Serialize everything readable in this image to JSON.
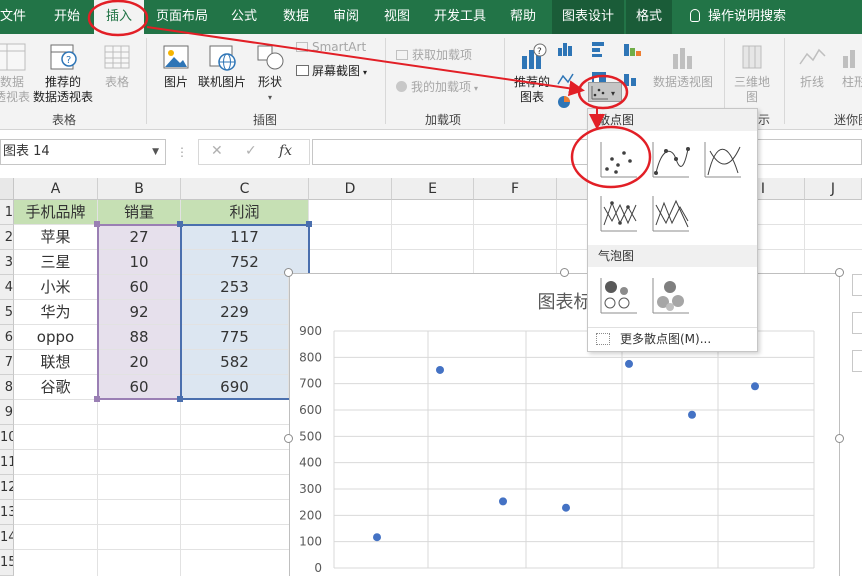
{
  "tabs": [
    {
      "label": "文件"
    },
    {
      "label": "开始"
    },
    {
      "label": "插入"
    },
    {
      "label": "页面布局"
    },
    {
      "label": "公式"
    },
    {
      "label": "数据"
    },
    {
      "label": "审阅"
    },
    {
      "label": "视图"
    },
    {
      "label": "开发工具"
    },
    {
      "label": "帮助"
    },
    {
      "label": "图表设计"
    },
    {
      "label": "格式"
    }
  ],
  "tellme": "操作说明搜索",
  "ribbon": {
    "pivot_label": [
      "数据",
      "透视表"
    ],
    "recommended_pivot_label": [
      "推荐的",
      "数据透视表"
    ],
    "table_label": "表格",
    "group_tables": "表格",
    "picture_label": "图片",
    "online_picture_label": "联机图片",
    "shapes_label": "形状",
    "smartart_label": "SmartArt",
    "screenshot_label": "屏幕截图",
    "group_illustrations": "插图",
    "get_addins_label": "获取加载项",
    "my_addins_label": "我的加载项",
    "group_addins": "加载项",
    "recommended_charts_label": [
      "推荐的",
      "图表"
    ],
    "pivot_chart_label": "数据透视图",
    "map3d_label": [
      "三维地",
      "图"
    ],
    "group_tours": "示",
    "line_label": "折线",
    "column_label": "柱形",
    "group_sparklines": "迷你图"
  },
  "formula_bar": {
    "name_box": "图表 14",
    "cancel": "✕",
    "enter": "✓",
    "fx": "fx"
  },
  "columns": [
    "A",
    "B",
    "C",
    "D",
    "E",
    "F",
    "G",
    "H",
    "I",
    "J"
  ],
  "rows": [
    "1",
    "2",
    "3",
    "4",
    "5",
    "6",
    "7",
    "8",
    "9",
    "10",
    "11",
    "12",
    "13",
    "14",
    "15"
  ],
  "table": {
    "headers": [
      "手机品牌",
      "销量",
      "利润"
    ],
    "rows": [
      [
        "苹果",
        "27",
        "117"
      ],
      [
        "三星",
        "10",
        "752"
      ],
      [
        "小米",
        "60",
        "253"
      ],
      [
        "华为",
        "92",
        "229"
      ],
      [
        "oppo",
        "88",
        "775"
      ],
      [
        "联想",
        "20",
        "582"
      ],
      [
        "谷歌",
        "60",
        "690"
      ]
    ]
  },
  "chart": {
    "title": "图表标"
  },
  "chart_data": {
    "type": "scatter",
    "title": "图表标",
    "x": [
      27,
      10,
      60,
      92,
      88,
      20,
      60
    ],
    "y": [
      117,
      752,
      253,
      229,
      775,
      582,
      690
    ],
    "ylim": [
      0,
      900
    ],
    "yticks": [
      "900",
      "800",
      "700",
      "600",
      "500",
      "400",
      "300",
      "200",
      "100",
      "0"
    ],
    "grid": true,
    "color": "#4472c4"
  },
  "dropdown": {
    "scatter_header": "散点图",
    "bubble_header": "气泡图",
    "more": "更多散点图(M)...",
    "items": [
      "scatter",
      "scatter-smooth-markers",
      "scatter-smooth-lines",
      "scatter-straight-markers",
      "scatter-straight-lines",
      "bubble",
      "bubble-3d"
    ]
  },
  "colors": {
    "ribbon_green": "#227447",
    "header_fill": "#c6e0b4",
    "annotation_red": "#e21f26",
    "marker_blue": "#4472c4"
  }
}
